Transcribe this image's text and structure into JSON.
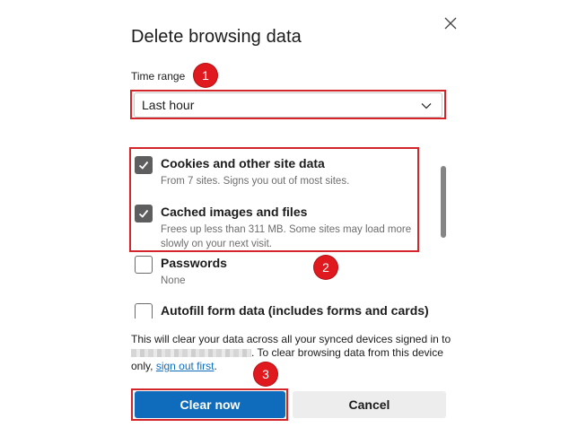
{
  "dialog": {
    "title": "Delete browsing data",
    "close_icon": "close-icon"
  },
  "time_range": {
    "label": "Time range",
    "selected": "Last hour"
  },
  "options": [
    {
      "label": "Cookies and other site data",
      "description": "From 7 sites. Signs you out of most sites.",
      "checked": true
    },
    {
      "label": "Cached images and files",
      "description": "Frees up less than 311 MB. Some sites may load more slowly on your next visit.",
      "checked": true
    },
    {
      "label": "Passwords",
      "description": "None",
      "checked": false
    },
    {
      "label": "Autofill form data (includes forms and cards)",
      "description": "",
      "checked": false
    }
  ],
  "info": {
    "text_before": "This will clear your data across all your synced devices signed in to",
    "text_middle": ". To clear browsing data from this device only,",
    "link": "sign out first",
    "text_after": "."
  },
  "buttons": {
    "clear": "Clear now",
    "cancel": "Cancel"
  },
  "annotations": [
    "1",
    "2",
    "3"
  ],
  "colors": {
    "accent": "#0f6cbd",
    "highlight": "#d4252b",
    "badge": "#e0191e",
    "checkbox_checked": "#5e5e5e"
  }
}
